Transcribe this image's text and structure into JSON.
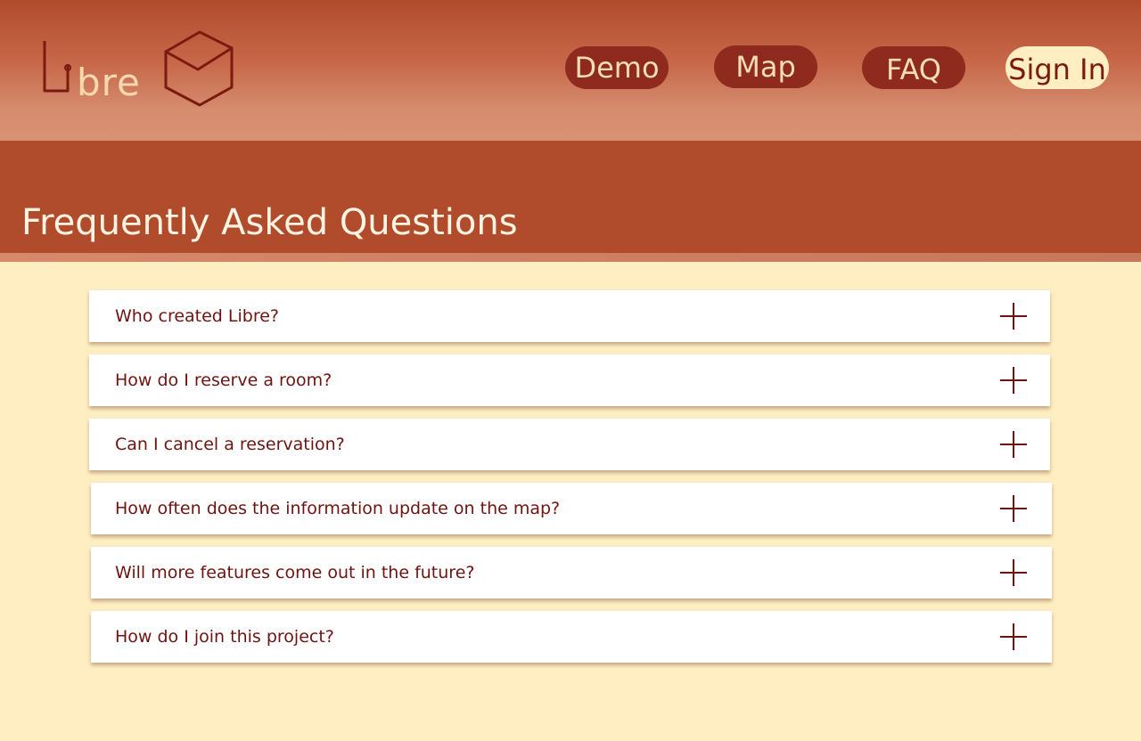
{
  "brand": {
    "name": "Libre",
    "text_after_i": "bre"
  },
  "nav": {
    "items": [
      {
        "label": "Demo"
      },
      {
        "label": "Map"
      },
      {
        "label": "FAQ"
      },
      {
        "label": "Sign In"
      }
    ]
  },
  "page": {
    "title": "Frequently Asked Questions"
  },
  "faq": {
    "items": [
      {
        "question": "Who created Libre?",
        "icon": "plus-icon"
      },
      {
        "question": "How do I reserve a room?",
        "icon": "plus-icon"
      },
      {
        "question": "Can I cancel a reservation?",
        "icon": "plus-icon"
      },
      {
        "question": "How often does the information update on the map?",
        "icon": "plus-icon"
      },
      {
        "question": "Will more features come out in the future?",
        "icon": "plus-icon"
      },
      {
        "question": "How do I join this project?",
        "icon": "plus-icon"
      }
    ]
  },
  "colors": {
    "header_top": "#B04C2C",
    "header_bottom": "#D89275",
    "banner": "#B04C2C",
    "nav_button": "#8E2A1E",
    "nav_text": "#F6DDB8",
    "signin_button": "#FFEEC2",
    "signin_text": "#7A1A10",
    "page_background": "#FFEEC2",
    "card": "#FFFFFF",
    "question_text": "#6E1410"
  }
}
